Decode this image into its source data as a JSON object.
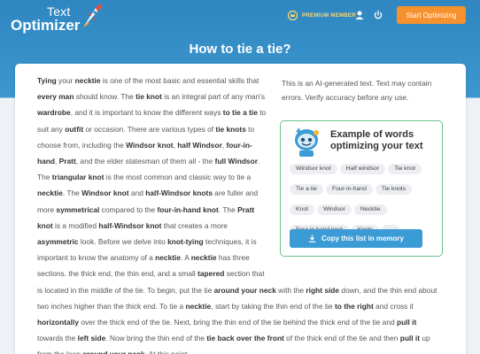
{
  "header": {
    "logo_line1": "Text",
    "logo_line2": "Optimizer",
    "premium_label": "PREMIUM MEMBER",
    "start_button": "Start Optimizing",
    "icons": [
      "crown-icon",
      "user-icon",
      "power-icon",
      "rocket-logo-icon"
    ],
    "accent_color": "#f5922e",
    "premium_color": "#ffd76a"
  },
  "page": {
    "title": "How to tie a tie?"
  },
  "side": {
    "note": "This is an AI-generated text. Text may contain errors. Verify accuracy before any use.",
    "example_title": "Example of words optimizing your text",
    "chips": [
      "Windsor knot",
      "Half windsor",
      "Tie knot",
      "Tie a tie",
      "Four-in-hand",
      "Tie knots",
      "Knot",
      "Windsor",
      "Necktie",
      "Four in hand knot",
      "Knots",
      "..."
    ],
    "copy_button": "Copy this list in memory",
    "border_color": "#6cc08b",
    "button_color": "#3a9bd5"
  },
  "article": {
    "segments": [
      [
        "b",
        "Tying"
      ],
      [
        " ",
        " your "
      ],
      [
        "b",
        "necktie"
      ],
      [
        " ",
        " is one of the most basic and essential skills that "
      ],
      [
        "b",
        "every man"
      ],
      [
        " ",
        " should know. The "
      ],
      [
        "b",
        "tie knot"
      ],
      [
        " ",
        " is an integral part of any man's "
      ],
      [
        "b",
        "wardrobe"
      ],
      [
        " ",
        ", and it is important to know the different ways "
      ],
      [
        "b",
        "to tie a tie"
      ],
      [
        " ",
        " to suit any "
      ],
      [
        "b",
        "outfit"
      ],
      [
        " ",
        " or occasion. There are various types of "
      ],
      [
        "b",
        "tie knots"
      ],
      [
        " ",
        " to choose from, including the "
      ],
      [
        "b",
        "Windsor knot"
      ],
      [
        " ",
        ", "
      ],
      [
        "b",
        "half Windsor"
      ],
      [
        " ",
        ", "
      ],
      [
        "b",
        "four-in-hand"
      ],
      [
        " ",
        ", "
      ],
      [
        "b",
        "Pratt"
      ],
      [
        " ",
        ", and the elder statesman of them all - the "
      ],
      [
        "b",
        "full Windsor"
      ],
      [
        " ",
        ". The "
      ],
      [
        "b",
        "triangular knot"
      ],
      [
        " ",
        " is the most common and classic way to tie a "
      ],
      [
        "b",
        "necktie"
      ],
      [
        " ",
        ". The "
      ],
      [
        "b",
        "Windsor knot"
      ],
      [
        " ",
        " and "
      ],
      [
        "b",
        "half-Windsor knots"
      ],
      [
        " ",
        " are fuller and more "
      ],
      [
        "b",
        "symmetrical"
      ],
      [
        " ",
        " compared to the "
      ],
      [
        "b",
        "four-in-hand knot"
      ],
      [
        " ",
        ". The "
      ],
      [
        "b",
        "Pratt knot"
      ],
      [
        " ",
        " is a modified "
      ],
      [
        "b",
        "half-Windsor knot"
      ],
      [
        " ",
        " that creates a more "
      ],
      [
        "b",
        "asymmetric"
      ],
      [
        " ",
        " look. Before we delve into "
      ],
      [
        "b",
        "knot-tying"
      ],
      [
        " ",
        " techniques, it is important to know the anatomy of a "
      ],
      [
        "b",
        "necktie"
      ],
      [
        " ",
        ". A "
      ],
      [
        "b",
        "necktie"
      ],
      [
        " ",
        " has three sections. the thick end, the thin end, and a small "
      ],
      [
        "b",
        "tapered"
      ],
      [
        " ",
        " section that is located in the middle of the tie. To begin, put the tie "
      ],
      [
        "b",
        "around your neck"
      ],
      [
        " ",
        " with the "
      ],
      [
        "b",
        "right side"
      ],
      [
        " ",
        " down, and the thin end about two inches higher than the thick end. To tie a "
      ],
      [
        "b",
        "necktie"
      ],
      [
        " ",
        ", start by taking the thin end of the tie "
      ],
      [
        "b",
        "to the right"
      ],
      [
        " ",
        " and cross it "
      ],
      [
        "b",
        "horizontally"
      ],
      [
        " ",
        " over the thick end of the tie. Next, bring the thin end of the tie behind the thick end of the tie and "
      ],
      [
        "b",
        "pull it"
      ],
      [
        " ",
        " towards the "
      ],
      [
        "b",
        "left side"
      ],
      [
        " ",
        ". Now bring the thin end of the "
      ],
      [
        "b",
        "tie back over the front"
      ],
      [
        " ",
        " of the thick end of the tie and then "
      ],
      [
        "b",
        "pull it"
      ],
      [
        " ",
        " up from the loop "
      ],
      [
        "b",
        "around your neck"
      ],
      [
        " ",
        ". At this point,"
      ]
    ]
  }
}
